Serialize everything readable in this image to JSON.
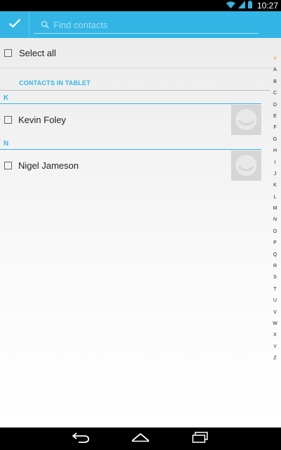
{
  "status_bar": {
    "time": "10:27",
    "icons": [
      "wifi-icon",
      "signal-icon",
      "battery-icon"
    ]
  },
  "action_bar": {
    "done_icon": "checkmark-icon",
    "search": {
      "placeholder": "Find contacts",
      "value": ""
    },
    "color": "#33b5e5"
  },
  "list": {
    "select_all_label": "Select all",
    "section_title": "CONTACTS IN TABLET",
    "groups": [
      {
        "letter": "K",
        "contacts": [
          {
            "name": "Kevin Foley",
            "checked": false
          }
        ]
      },
      {
        "letter": "N",
        "contacts": [
          {
            "name": "Nigel Jameson",
            "checked": false
          }
        ]
      }
    ]
  },
  "index_bar": [
    "#",
    "A",
    "B",
    "C",
    "D",
    "E",
    "F",
    "G",
    "H",
    "I",
    "J",
    "K",
    "L",
    "M",
    "N",
    "O",
    "P",
    "Q",
    "R",
    "S",
    "T",
    "U",
    "V",
    "W",
    "X",
    "Y",
    "Z"
  ],
  "nav_bar": {
    "buttons": [
      "back-icon",
      "home-icon",
      "recent-apps-icon"
    ]
  }
}
